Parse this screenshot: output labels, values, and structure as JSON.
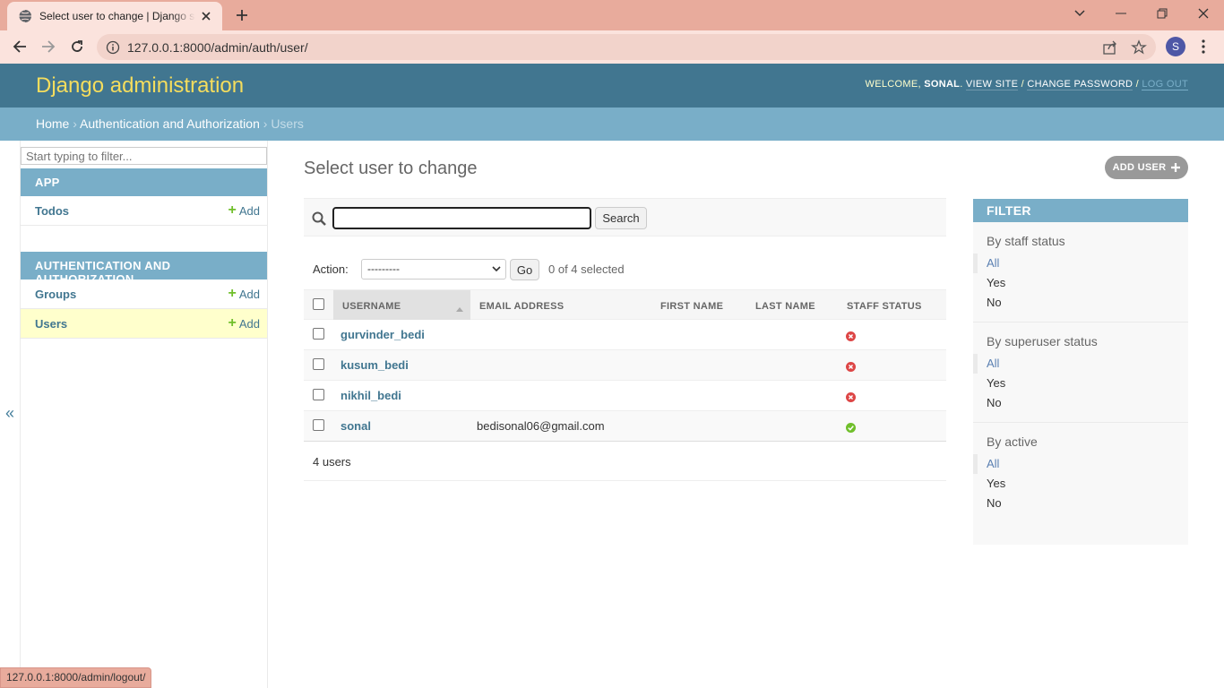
{
  "browser": {
    "tab_title": "Select user to change | Django site admin",
    "url": "127.0.0.1:8000/admin/auth/user/",
    "profile_initial": "S",
    "status_url": "127.0.0.1:8000/admin/logout/"
  },
  "header": {
    "branding": "Django administration",
    "welcome": "WELCOME,",
    "username": "SONAL",
    "view_site": "VIEW SITE",
    "change_password": "CHANGE PASSWORD",
    "log_out": "LOG OUT",
    "sep": "/"
  },
  "breadcrumbs": {
    "home": "Home",
    "app": "Authentication and Authorization",
    "current": "Users",
    "sep": "›"
  },
  "sidebar": {
    "filter_placeholder": "Start typing to filter...",
    "toggle": "«",
    "modules": [
      {
        "caption": "APP",
        "models": [
          {
            "name": "Todos",
            "add": "Add"
          }
        ]
      },
      {
        "caption": "AUTHENTICATION AND AUTHORIZATION",
        "models": [
          {
            "name": "Groups",
            "add": "Add"
          },
          {
            "name": "Users",
            "add": "Add"
          }
        ]
      }
    ]
  },
  "content": {
    "title": "Select user to change",
    "add_user": "ADD USER",
    "search_button": "Search",
    "action_label": "Action:",
    "action_selected": "---------",
    "go": "Go",
    "counter": "0 of 4 selected",
    "columns": [
      "USERNAME",
      "EMAIL ADDRESS",
      "FIRST NAME",
      "LAST NAME",
      "STAFF STATUS"
    ],
    "rows": [
      {
        "username": "gurvinder_bedi",
        "email": "",
        "first_name": "",
        "last_name": "",
        "staff": false
      },
      {
        "username": "kusum_bedi",
        "email": "",
        "first_name": "",
        "last_name": "",
        "staff": false
      },
      {
        "username": "nikhil_bedi",
        "email": "",
        "first_name": "",
        "last_name": "",
        "staff": false
      },
      {
        "username": "sonal",
        "email": "bedisonal06@gmail.com",
        "first_name": "",
        "last_name": "",
        "staff": true
      }
    ],
    "paginator": "4 users"
  },
  "filter": {
    "title": "FILTER",
    "groups": [
      {
        "title": "By staff status",
        "options": [
          "All",
          "Yes",
          "No"
        ]
      },
      {
        "title": "By superuser status",
        "options": [
          "All",
          "Yes",
          "No"
        ]
      },
      {
        "title": "By active",
        "options": [
          "All",
          "Yes",
          "No"
        ]
      }
    ]
  },
  "colors": {
    "header": "#417690",
    "breadcrumbs": "#79aec8",
    "branding": "#f5dd5d",
    "link": "#417690",
    "no_icon": "#dd4646",
    "yes_icon": "#70bf2b"
  }
}
